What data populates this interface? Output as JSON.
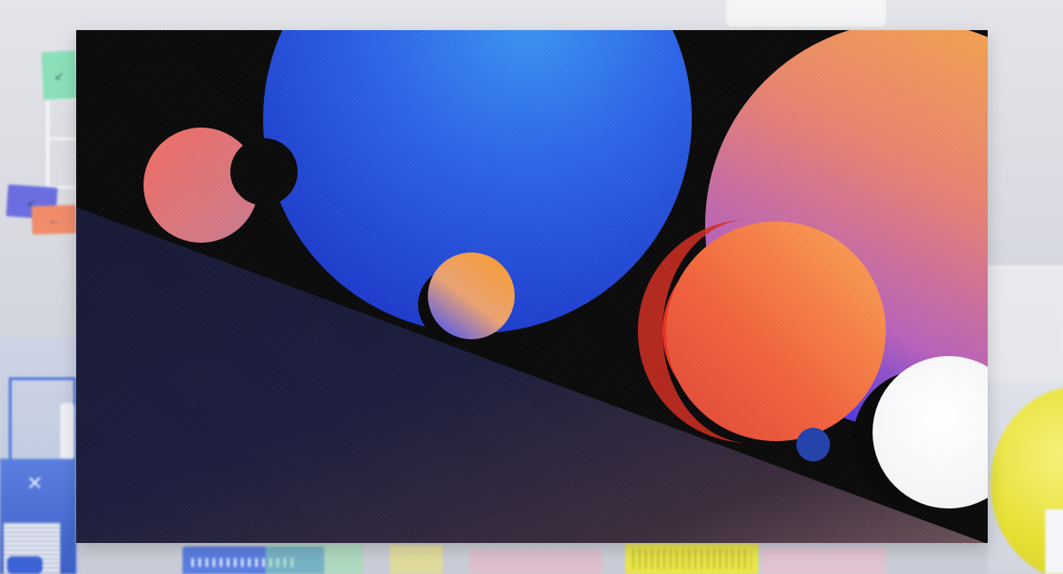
{
  "scene": {
    "left_notes": [
      {
        "name": "green-sticky-note",
        "color": "#8be0b9",
        "icon": "arrow-left-icon"
      },
      {
        "name": "purple-sticky-note",
        "color": "#6b6ee0",
        "icon": "arrow-down-left-icon"
      },
      {
        "name": "orange-sticky-note",
        "color": "#f08c6a",
        "icon": "arrow-left-icon"
      }
    ],
    "colors": {
      "card_background": "#070707",
      "blue_sphere": "#2a62e6",
      "peach_sphere": "#ef9a6a",
      "orange_sphere": "#f0603a",
      "white_sphere": "#ffffff",
      "small_blue_dot": "#1f3fa8",
      "yellow_disc": "#e6e034"
    }
  }
}
